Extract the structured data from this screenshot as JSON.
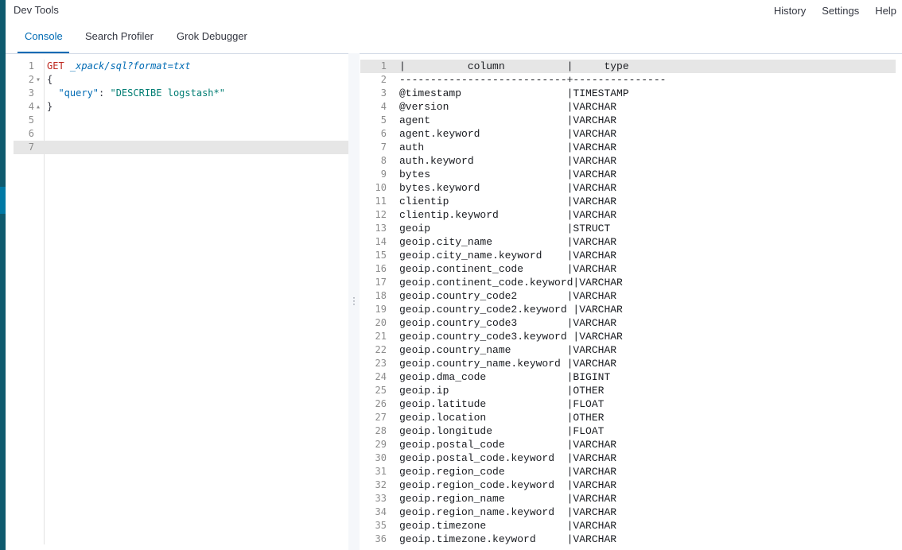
{
  "app": {
    "title": "Dev Tools"
  },
  "header_menu": [
    "History",
    "Settings",
    "Help"
  ],
  "tabs": [
    {
      "label": "Console",
      "active": true
    },
    {
      "label": "Search Profiler",
      "active": false
    },
    {
      "label": "Grok Debugger",
      "active": false
    }
  ],
  "editor": {
    "lines": [
      {
        "num": "1",
        "fold": "",
        "method": "GET",
        "url": "_xpack/sql?format=txt"
      },
      {
        "num": "2",
        "fold": "▾",
        "text": "{"
      },
      {
        "num": "3",
        "fold": "",
        "key": "\"query\"",
        "sep": ": ",
        "value": "\"DESCRIBE logstash*\""
      },
      {
        "num": "4",
        "fold": "▴",
        "text": "}"
      },
      {
        "num": "5",
        "fold": "",
        "text": ""
      },
      {
        "num": "6",
        "fold": "",
        "text": ""
      },
      {
        "num": "7",
        "fold": "",
        "text": ""
      }
    ],
    "active_line": 7
  },
  "output": {
    "lines": [
      "|          column          |     type",
      "---------------------------+---------------",
      "@timestamp                 |TIMESTAMP",
      "@version                   |VARCHAR",
      "agent                      |VARCHAR",
      "agent.keyword              |VARCHAR",
      "auth                       |VARCHAR",
      "auth.keyword               |VARCHAR",
      "bytes                      |VARCHAR",
      "bytes.keyword              |VARCHAR",
      "clientip                   |VARCHAR",
      "clientip.keyword           |VARCHAR",
      "geoip                      |STRUCT",
      "geoip.city_name            |VARCHAR",
      "geoip.city_name.keyword    |VARCHAR",
      "geoip.continent_code       |VARCHAR",
      "geoip.continent_code.keyword|VARCHAR",
      "geoip.country_code2        |VARCHAR",
      "geoip.country_code2.keyword |VARCHAR",
      "geoip.country_code3        |VARCHAR",
      "geoip.country_code3.keyword |VARCHAR",
      "geoip.country_name         |VARCHAR",
      "geoip.country_name.keyword |VARCHAR",
      "geoip.dma_code             |BIGINT",
      "geoip.ip                   |OTHER",
      "geoip.latitude             |FLOAT",
      "geoip.location             |OTHER",
      "geoip.longitude            |FLOAT",
      "geoip.postal_code          |VARCHAR",
      "geoip.postal_code.keyword  |VARCHAR",
      "geoip.region_code          |VARCHAR",
      "geoip.region_code.keyword  |VARCHAR",
      "geoip.region_name          |VARCHAR",
      "geoip.region_name.keyword  |VARCHAR",
      "geoip.timezone             |VARCHAR",
      "geoip.timezone.keyword     |VARCHAR"
    ]
  }
}
